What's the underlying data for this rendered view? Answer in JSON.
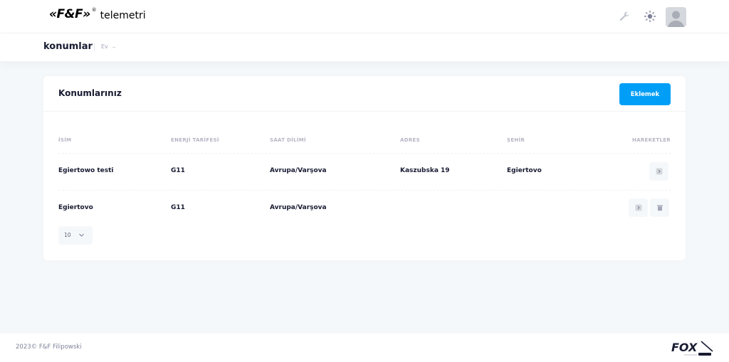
{
  "header": {
    "logo": "«F&F»",
    "logo_mark": "®",
    "app_name": "telemetri",
    "icons": [
      "wrench-icon",
      "sun-icon",
      "avatar-icon"
    ]
  },
  "toolbar": {
    "page_title": "konumlar",
    "breadcrumb": "Ev"
  },
  "card": {
    "title": "Konumlarınız",
    "add_button": "Eklemek"
  },
  "table": {
    "columns": [
      "İSİM",
      "ENERJİ TARİFESİ",
      "SAAT DİLİMİ",
      "ADRES",
      "ŞEHİR",
      "HAREKETLER"
    ],
    "rows": [
      {
        "name": "Egiertowo testi",
        "tariff": "G11",
        "timezone": "Avrupa/Varşova",
        "address": "Kaszubska 19",
        "city": "Egiertovo"
      },
      {
        "name": "Egiertovo",
        "tariff": "G11",
        "timezone": "Avrupa/Varşova",
        "address": "",
        "city": ""
      }
    ]
  },
  "pagination": {
    "page_size": "10"
  },
  "footer": {
    "copyright": "2023© F&F Filipowski",
    "brand_logo": "FOX"
  },
  "colors": {
    "accent": "#009ef7",
    "background": "#f5f8fa",
    "text": "#181c32",
    "muted": "#b5b5c3"
  }
}
